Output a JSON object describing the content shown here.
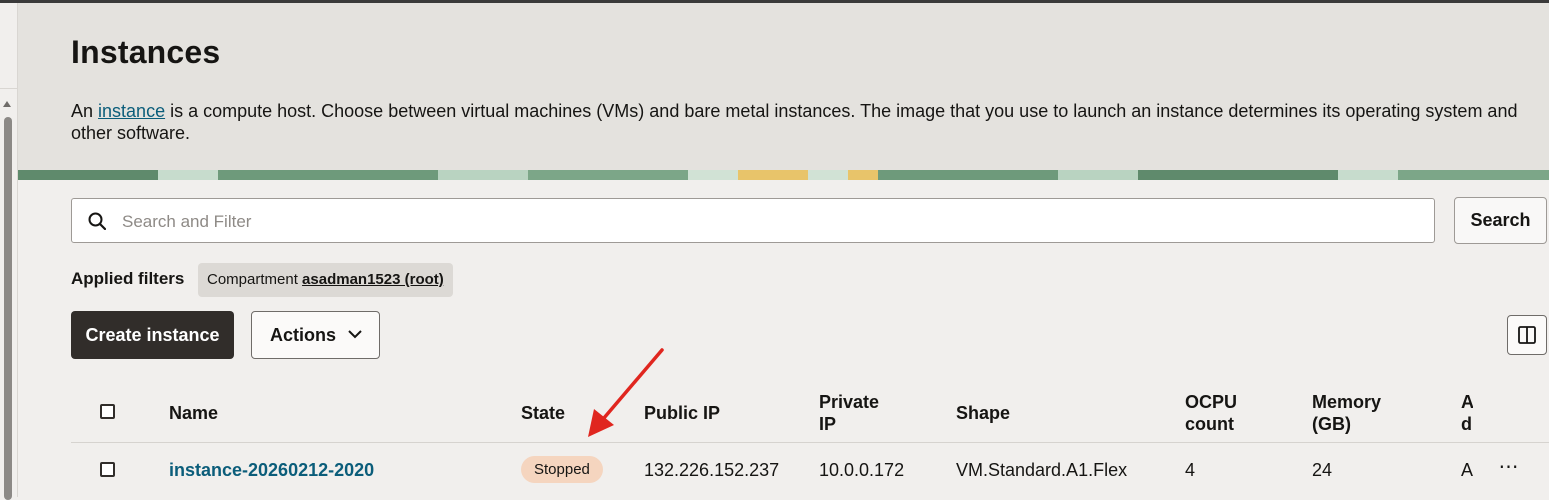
{
  "header": {
    "title": "Instances",
    "desc_prefix": "An ",
    "desc_link": "instance",
    "desc_rest": " is a compute host. Choose between virtual machines (VMs) and bare metal instances. The image that you use to launch an instance determines its operating system and other software."
  },
  "search": {
    "placeholder": "Search and Filter",
    "button_label": "Search"
  },
  "filters": {
    "label": "Applied filters",
    "chip_key": "Compartment ",
    "chip_value": "asadman1523 (root)"
  },
  "toolbar": {
    "create_label": "Create instance",
    "actions_label": "Actions"
  },
  "table": {
    "headers": {
      "name": "Name",
      "state": "State",
      "public_ip": "Public IP",
      "private_ip_1": "Private",
      "private_ip_2": "IP",
      "shape": "Shape",
      "ocpu_1": "OCPU",
      "ocpu_2": "count",
      "memory_1": "Memory",
      "memory_2": "(GB)",
      "extra_1": "A",
      "extra_2": "d"
    },
    "rows": [
      {
        "name": "instance-20260212-2020",
        "state": "Stopped",
        "public_ip": "132.226.152.237",
        "private_ip": "10.0.0.172",
        "shape": "VM.Standard.A1.Flex",
        "ocpu": "4",
        "memory": "24",
        "extra": "A",
        "more": "⋯"
      }
    ]
  },
  "colors": {
    "accent_link": "#0b5d7a",
    "primary_button": "#312d2a",
    "state_stopped_bg": "#f5d5bf",
    "annotation_arrow": "#e0261f"
  }
}
